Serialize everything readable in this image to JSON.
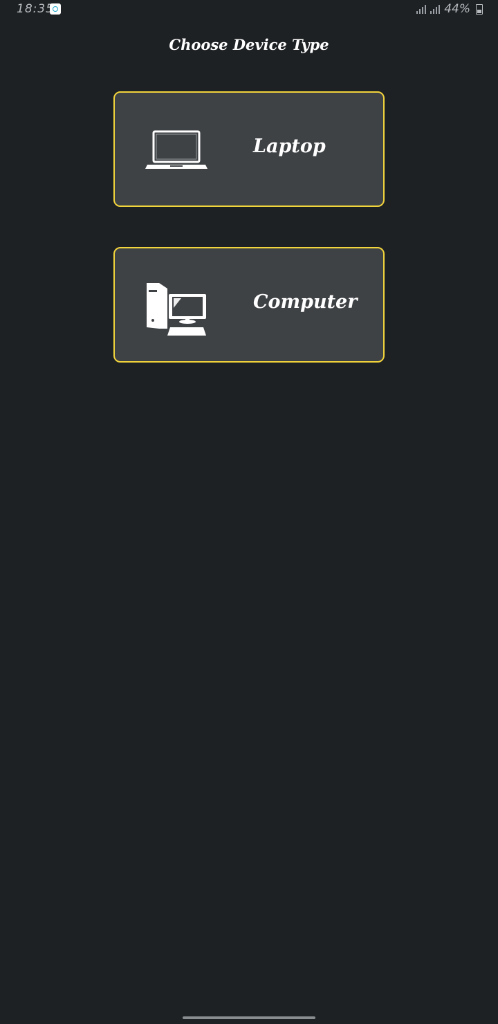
{
  "status_bar": {
    "time": "18:35",
    "battery": "44%"
  },
  "page": {
    "title": "Choose Device Type"
  },
  "devices": [
    {
      "label": "Laptop",
      "icon": "laptop-icon"
    },
    {
      "label": "Computer",
      "icon": "desktop-computer-icon"
    }
  ],
  "colors": {
    "background": "#1e2124",
    "card": "#3f4245",
    "accent_border": "#f2d43c",
    "text": "#ffffff"
  }
}
